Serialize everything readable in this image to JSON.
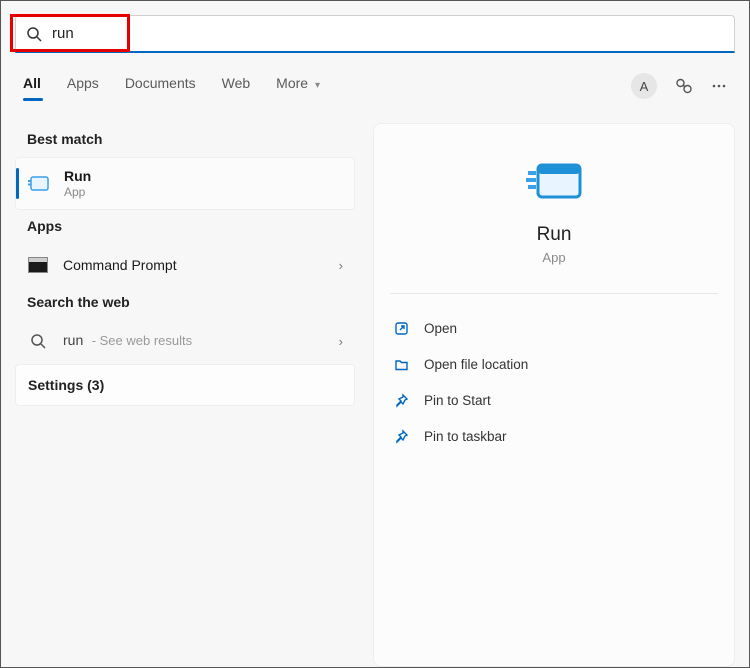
{
  "search": {
    "value": "run"
  },
  "tabs": {
    "all": "All",
    "apps": "Apps",
    "documents": "Documents",
    "web": "Web",
    "more": "More"
  },
  "avatar_letter": "A",
  "left": {
    "best_match_header": "Best match",
    "best_match": {
      "title": "Run",
      "sub": "App"
    },
    "apps_header": "Apps",
    "apps": [
      {
        "title": "Command Prompt"
      }
    ],
    "web_header": "Search the web",
    "web": {
      "query": "run",
      "suffix": "- See web results"
    },
    "settings_label": "Settings (3)"
  },
  "right": {
    "title": "Run",
    "sub": "App",
    "actions": {
      "open": "Open",
      "open_file_location": "Open file location",
      "pin_start": "Pin to Start",
      "pin_taskbar": "Pin to taskbar"
    }
  }
}
